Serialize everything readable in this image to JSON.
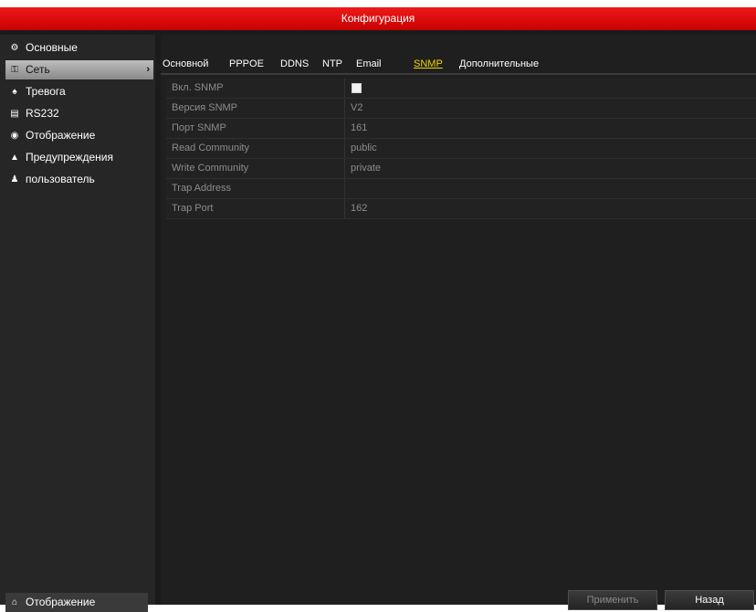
{
  "window": {
    "title": "Конфигурация"
  },
  "sidebar": {
    "items": [
      {
        "label": "Основные",
        "icon": "gear-icon"
      },
      {
        "label": "Сеть",
        "icon": "network-icon",
        "arrow": "›"
      },
      {
        "label": "Тревога",
        "icon": "alarm-icon"
      },
      {
        "label": "RS232",
        "icon": "serial-port-icon"
      },
      {
        "label": "Отображение",
        "icon": "eye-icon"
      },
      {
        "label": "Предупреждения",
        "icon": "warning-icon"
      },
      {
        "label": "пользователь",
        "icon": "users-icon"
      }
    ],
    "bottom": {
      "label": "Отображение",
      "icon": "home-icon"
    },
    "active_index": 1
  },
  "tabs": [
    {
      "label": "Основной"
    },
    {
      "label": "PPPOE"
    },
    {
      "label": "DDNS"
    },
    {
      "label": "NTP"
    },
    {
      "label": "Email"
    },
    {
      "label": "SNMP"
    },
    {
      "label": "Дополнительные"
    }
  ],
  "active_tab_index": 5,
  "form": {
    "rows": [
      {
        "label": "Вкл. SNMP",
        "value": "",
        "type": "checkbox",
        "checked": false
      },
      {
        "label": "Версия SNMP",
        "value": "V2",
        "type": "text"
      },
      {
        "label": "Порт SNMP",
        "value": "161",
        "type": "text"
      },
      {
        "label": "Read Community",
        "value": "public",
        "type": "text"
      },
      {
        "label": "Write Community",
        "value": "private",
        "type": "text"
      },
      {
        "label": "Trap Address",
        "value": "",
        "type": "text"
      },
      {
        "label": "Trap Port",
        "value": "162",
        "type": "text"
      }
    ]
  },
  "buttons": {
    "apply": "Применить",
    "back": "Назад"
  },
  "colors": {
    "title_bar": "#e00000",
    "active_tab": "#f2d600",
    "background": "#1f1f1f"
  }
}
